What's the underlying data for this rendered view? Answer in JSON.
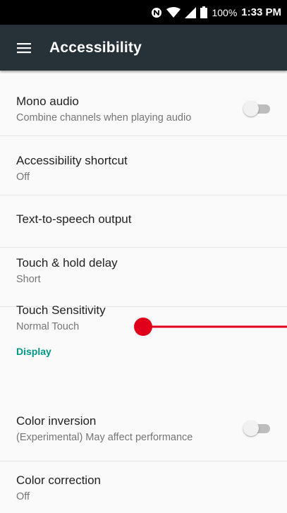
{
  "status_bar": {
    "icons": [
      "nfc-icon",
      "wifi-icon",
      "cellular-signal-icon",
      "battery-icon"
    ],
    "battery_percent": "100%",
    "time": "1:33 PM"
  },
  "app_bar": {
    "menu_icon": "hamburger-menu-icon",
    "title": "Accessibility",
    "background": "#263238"
  },
  "items": [
    {
      "title": "Mono audio",
      "summary": "Combine channels when playing audio",
      "toggle": "off"
    },
    {
      "title": "Accessibility shortcut",
      "summary": "Off"
    },
    {
      "title": "Text-to-speech output"
    },
    {
      "title": "Touch & hold delay",
      "summary": "Short"
    },
    {
      "title": "Touch Sensitivity",
      "summary": "Normal Touch"
    }
  ],
  "display_section": {
    "header": "Display",
    "header_color": "#009688",
    "items": [
      {
        "title": "Color inversion",
        "summary": "(Experimental) May affect performance",
        "toggle": "off"
      },
      {
        "title": "Color correction",
        "summary": "Off"
      }
    ]
  },
  "touch_indicator_color": "#e0001b"
}
